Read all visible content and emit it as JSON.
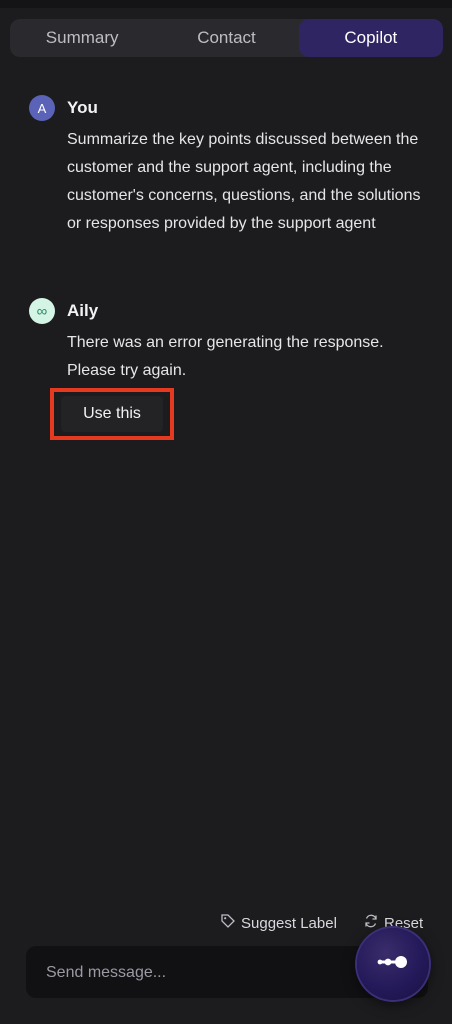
{
  "tabs": [
    {
      "label": "Summary",
      "active": false
    },
    {
      "label": "Contact",
      "active": false
    },
    {
      "label": "Copilot",
      "active": true
    }
  ],
  "messages": [
    {
      "avatar": "A",
      "author": "You",
      "text": "Summarize the key points discussed between the customer and the support agent, including the customer's concerns, questions, and the solutions or responses provided by the support agent"
    },
    {
      "avatar_icon": "infinity-icon",
      "author": "Aily",
      "text": "There was an error generating the response. Please try again.",
      "action_label": "Use this"
    }
  ],
  "footer": {
    "suggest_label": "Suggest Label",
    "reset_label": "Reset",
    "input_placeholder": "Send message...",
    "input_value": ""
  },
  "colors": {
    "background": "#1c1c1e",
    "tab_active": "#2f2563",
    "highlight_frame": "#e53a1f",
    "user_avatar": "#5a63b8",
    "ai_avatar": "#d4f5e6"
  }
}
